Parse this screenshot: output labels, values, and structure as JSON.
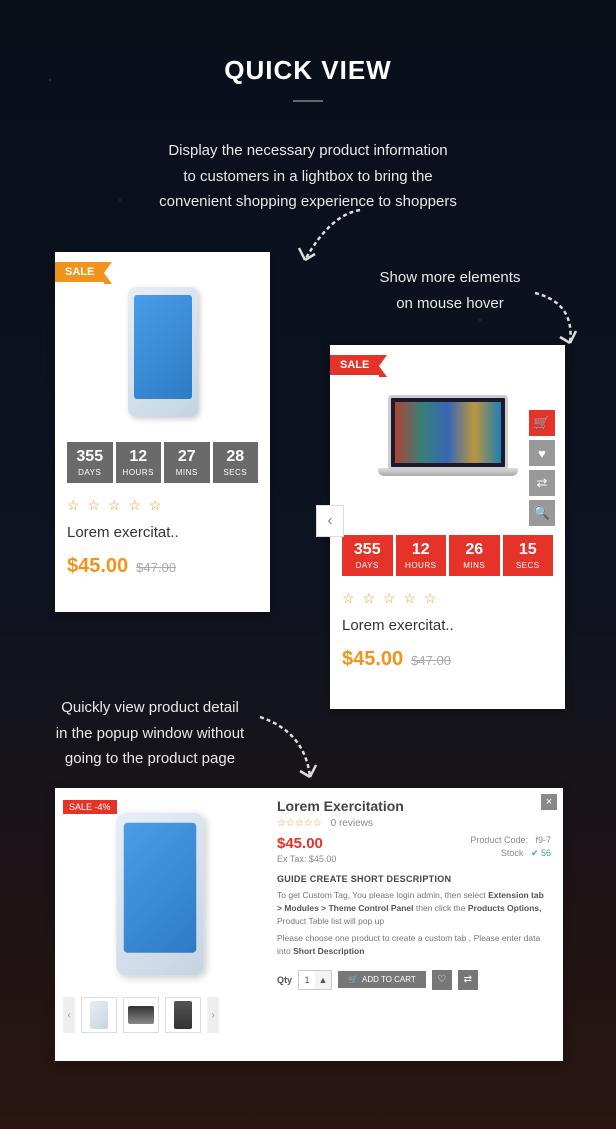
{
  "title": "QUICK VIEW",
  "intro_l1": "Display the necessary product information",
  "intro_l2": "to customers in a lightbox to bring the",
  "intro_l3": "convenient shopping experience to shoppers",
  "cap1_l1": "Show more elements",
  "cap1_l2": "on mouse hover",
  "cap2_l1": "Quickly view product detail",
  "cap2_l2": "in the popup window without",
  "cap2_l3": "going to the product page",
  "card1": {
    "sale": "SALE",
    "timer": {
      "days": "355",
      "hours": "12",
      "mins": "27",
      "secs": "28"
    },
    "tlabels": {
      "days": "DAYS",
      "hours": "HOURS",
      "mins": "MINS",
      "secs": "SECS"
    },
    "name": "Lorem exercitat..",
    "price": "$45.00",
    "old": "$47.00"
  },
  "card2": {
    "sale": "SALE",
    "timer": {
      "days": "355",
      "hours": "12",
      "mins": "26",
      "secs": "15"
    },
    "tlabels": {
      "days": "DAYS",
      "hours": "HOURS",
      "mins": "MINS",
      "secs": "SECS"
    },
    "name": "Lorem exercitat..",
    "price": "$45.00",
    "old": "$47.00"
  },
  "popup": {
    "sale": "SALE -4%",
    "title": "Lorem Exercitation",
    "reviews": "0 reviews",
    "price": "$45.00",
    "extax": "Ex Tax: $45.00",
    "code_l": "Product Code:",
    "code_v": "f9-7",
    "stock_l": "Stock",
    "stock_v": "✔ 56",
    "guide": "GUIDE CREATE SHORT DESCRIPTION",
    "g1a": "To get Custom Tag, You please login admin, then select ",
    "g1b": "Extension tab > Modules > Theme Control Panel",
    "g1c": " then click the ",
    "g1d": "Products Options,",
    "g1e": " Product Table list will pop up",
    "g2a": "Please choose one product to create a custom tab , Please enter data into ",
    "g2b": "Short Description",
    "qty_l": "Qty",
    "qty_v": "1",
    "addcart": "ADD TO CART"
  }
}
